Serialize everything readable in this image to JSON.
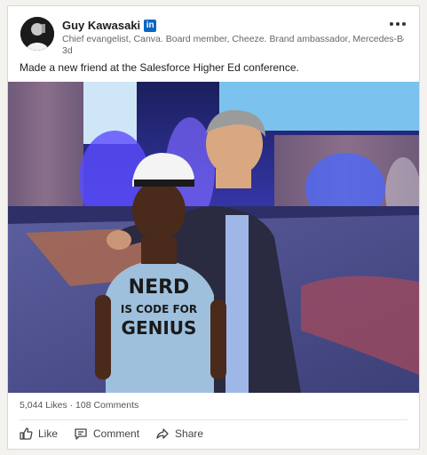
{
  "post": {
    "author": "Guy Kawasaki",
    "badge": "in",
    "tagline": "Chief evangelist, Canva. Board member, Cheeze. Brand ambassador, Mercedes-Benz.",
    "time": "3d",
    "text": "Made a new friend at the Salesforce Higher Ed conference.",
    "shirt_lines": [
      "NERD",
      "IS CODE FOR",
      "GENIUS"
    ]
  },
  "stats": {
    "summary": "5,044 Likes · 108 Comments"
  },
  "actions": {
    "like": "Like",
    "comment": "Comment",
    "share": "Share"
  },
  "icons": {
    "more": "more-options-icon",
    "like": "thumbs-up-icon",
    "comment": "comment-icon",
    "share": "share-arrow-icon",
    "badge": "linkedin-badge-icon"
  },
  "colors": {
    "brand": "#0a66c2"
  }
}
